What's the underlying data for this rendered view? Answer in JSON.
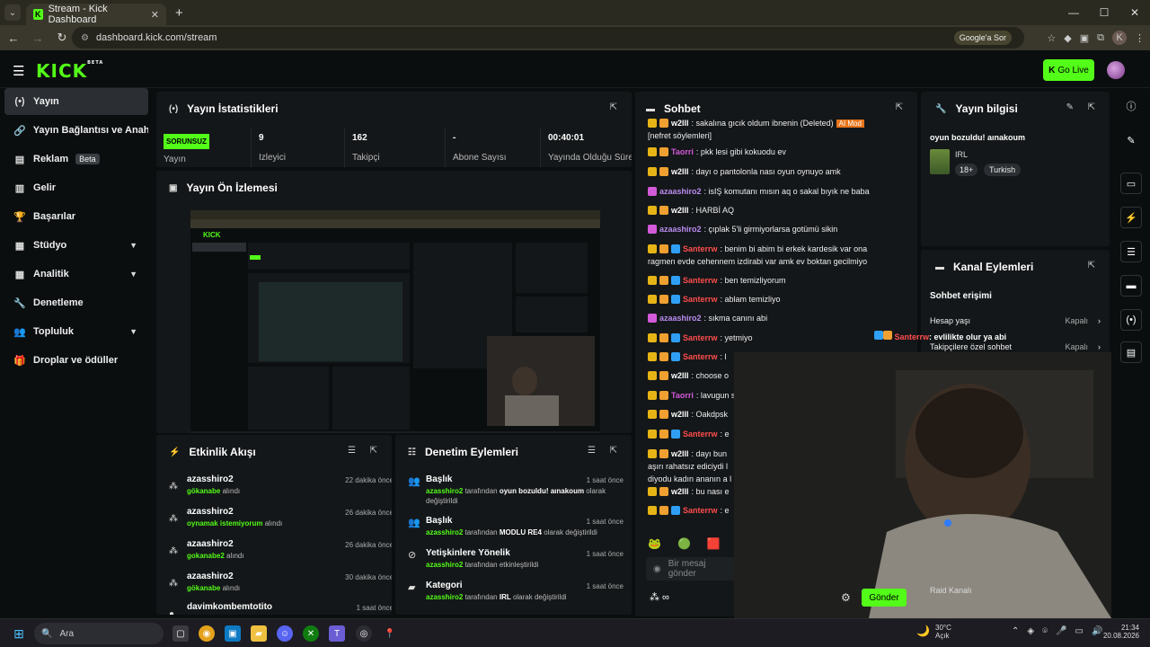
{
  "browser": {
    "tab_title": "Stream - Kick Dashboard",
    "url": "dashboard.kick.com/stream",
    "google_btn": "Google'a Sor",
    "profile_initial": "K"
  },
  "header": {
    "logo": "KICK",
    "logo_beta": "BETA",
    "go_live": "Go Live"
  },
  "sidebar": {
    "items": [
      {
        "label": "Yayın",
        "icon": "broadcast-icon"
      },
      {
        "label": "Yayın Bağlantısı ve Anahtar",
        "icon": "link-icon"
      },
      {
        "label": "Reklam",
        "icon": "ad-icon",
        "badge": "Beta"
      },
      {
        "label": "Gelir",
        "icon": "chart-icon"
      },
      {
        "label": "Başarılar",
        "icon": "trophy-icon"
      },
      {
        "label": "Stüdyo",
        "icon": "studio-icon"
      },
      {
        "label": "Analitik",
        "icon": "analytics-icon"
      },
      {
        "label": "Denetleme",
        "icon": "wrench-icon"
      },
      {
        "label": "Topluluk",
        "icon": "community-icon"
      },
      {
        "label": "Droplar ve ödüller",
        "icon": "gift-icon"
      }
    ]
  },
  "stats": {
    "title": "Yayın İstatistikleri",
    "status": "SORUNSUZ",
    "status_label": "Yayın",
    "cells": [
      {
        "value": "9",
        "label": "İzleyici"
      },
      {
        "value": "162",
        "label": "Takipçi"
      },
      {
        "value": "-",
        "label": "Abone Sayısı"
      },
      {
        "value": "00:40:01",
        "label": "Yayında Olduğu Süre"
      }
    ]
  },
  "preview": {
    "title": "Yayın Ön İzlemesi"
  },
  "chat": {
    "title": "Sohbet",
    "placeholder": "Bir mesaj gönder",
    "send": "Gönder",
    "messages": [
      {
        "user": "w2lll",
        "text": ": sakalına gıcık oldum ibnenin (Deleted)",
        "tag": "AI Mod",
        "extra": "[nefret söylemleri]",
        "color": "#ffffff"
      },
      {
        "user": "Taorri",
        "text": ": pkk lesi gibi kokuodu ev",
        "color": "#d35ad9"
      },
      {
        "user": "w2lll",
        "text": ": dayı o pantolonla nası oyun oynuyo amk",
        "color": "#ffffff"
      },
      {
        "user": "azaashiro2",
        "text": ": isIŞ komutanı mısın aq o sakal bıyık ne baba",
        "color": "#b98cf0"
      },
      {
        "user": "w2lll",
        "text": ": HARBİ AQ",
        "color": "#ffffff"
      },
      {
        "user": "azaashiro2",
        "text": ": çıplak 5'li girmiyorlarsa gotümü sikin",
        "color": "#b98cf0"
      },
      {
        "user": "Santerrw",
        "text": ": benim bi abim bi erkek kardesik var ona",
        "text2": "ragmen evde cehennem izdirabi var amk ev boktan gecilmiyo",
        "color": "#ff4d4d"
      },
      {
        "user": "Santerrw",
        "text": ": ben temizliyorum",
        "color": "#ff4d4d"
      },
      {
        "user": "Santerrw",
        "text": ": ablam temizliyo",
        "color": "#ff4d4d"
      },
      {
        "user": "azaashiro2",
        "text": ": sıkma canını abi",
        "color": "#b98cf0"
      },
      {
        "user": "Santerrw",
        "text": ": yetmiyo",
        "color": "#ff4d4d"
      },
      {
        "user": "Santerrw",
        "text": ": l",
        "color": "#ff4d4d"
      },
      {
        "user": "w2lll",
        "text": ": choose o",
        "color": "#ffffff"
      },
      {
        "user": "Taorri",
        "text": ": lavugun se",
        "color": "#d35ad9"
      },
      {
        "user": "w2lll",
        "text": ": Oakdpsk",
        "color": "#ffffff"
      },
      {
        "user": "Santerrw",
        "text": ": e",
        "color": "#ff4d4d"
      },
      {
        "user": "w2lll",
        "text": ": dayı bun",
        "text2": "aşırı rahatsız ediciydi l",
        "text3": "diyodu kadın ananın a l",
        "color": "#ffffff"
      },
      {
        "user": "w2lll",
        "text": ": bu nası e",
        "color": "#ffffff"
      },
      {
        "user": "Santerrw",
        "text": ": e",
        "color": "#ff4d4d"
      }
    ],
    "overlay": {
      "user": "Santerrw",
      "text": ": evlilikte olur ya abi"
    }
  },
  "info": {
    "title": "Yayın bilgisi",
    "stream_title": "oyun bozuldu! aınakoum",
    "category": "IRL",
    "tags": [
      "18+",
      "Turkish"
    ]
  },
  "channel": {
    "title": "Kanal Eylemleri",
    "section": "Sohbet erişimi",
    "rows": [
      {
        "label": "Hesap yaşı",
        "value": "Kapalı"
      },
      {
        "label": "Takipçilere özel sohbet",
        "value": "Kapalı"
      }
    ],
    "raid": "Raid Kanalı"
  },
  "events": {
    "title": "Etkinlik Akışı",
    "items": [
      {
        "name": "azasshiro2",
        "detail_user": "gökanabe",
        "detail": " alındı",
        "time": "22 dakika önce"
      },
      {
        "name": "azasshiro2",
        "detail_user": "oynamak istemiyorum",
        "detail": " alındı",
        "time": "26 dakika önce"
      },
      {
        "name": "azaashiro2",
        "detail_user": "gokanabe2",
        "detail": " alındı",
        "time": "26 dakika önce"
      },
      {
        "name": "azaashiro2",
        "detail_user": "gökanabe",
        "detail": " alındı",
        "time": "30 dakika önce"
      },
      {
        "name": "davimkombemtotito",
        "detail_user": "",
        "detail": "",
        "time": "1 saat önce"
      }
    ]
  },
  "moderation": {
    "title": "Denetim Eylemleri",
    "items": [
      {
        "name": "Başlık",
        "user": "azasshiro2",
        "mid": " tarafından ",
        "value": "oyun bozuldu! aınakoum",
        "end": " olarak değiştirildi",
        "time": "1 saat önce",
        "icon": "community-icon"
      },
      {
        "name": "Başlık",
        "user": "azasshiro2",
        "mid": " tarafından ",
        "value": "MODLU RE4",
        "end": " olarak değiştirildi",
        "time": "1 saat önce",
        "icon": "community-icon"
      },
      {
        "name": "Yetişkinlere Yönelik",
        "user": "azasshiro2",
        "mid": " tarafından etkinleştirildi",
        "value": "",
        "end": "",
        "time": "1 saat önce",
        "icon": "eye-off-icon"
      },
      {
        "name": "Kategori",
        "user": "azasshiro2",
        "mid": " tarafından ",
        "value": "IRL",
        "end": " olarak değiştirildi",
        "time": "1 saat önce",
        "icon": "folder-icon"
      }
    ]
  },
  "taskbar": {
    "search": "Ara",
    "weather_temp": "30°C",
    "weather_desc": "Açık",
    "time": "21:34",
    "date": "20.08.2026"
  }
}
